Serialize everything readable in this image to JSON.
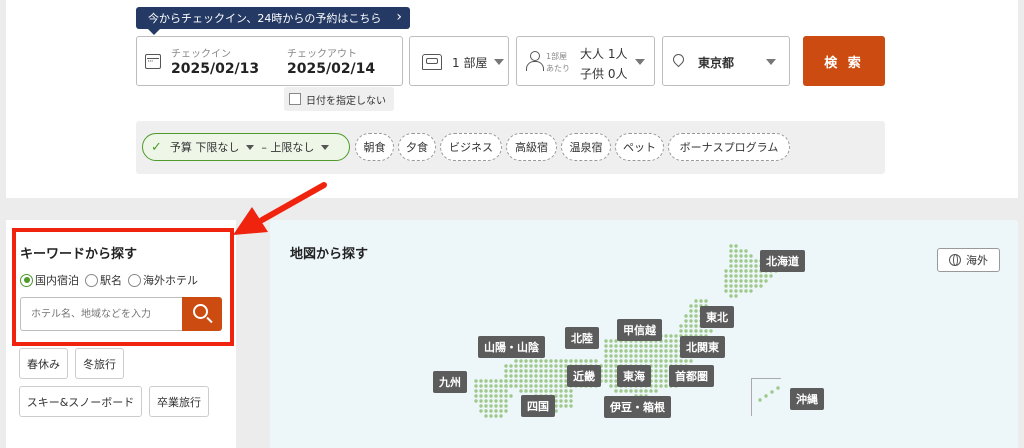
{
  "notice": {
    "text": "今からチェックイン、24時からの予約はこちら"
  },
  "dates": {
    "checkin_label": "チェックイン",
    "checkin_value": "2025/02/13",
    "checkout_label": "チェックアウト",
    "checkout_value": "2025/02/14",
    "no_date_label": "日付を指定しない"
  },
  "rooms": {
    "value": "1 部屋"
  },
  "guests": {
    "per_room_line1": "1部屋",
    "per_room_line2": "あたり",
    "adults": "大人 1人",
    "children": "子供 0人"
  },
  "location": {
    "value": "東京都"
  },
  "search_button": "検 索",
  "filters": {
    "budget_prefix": "予算",
    "budget_min": "下限なし",
    "budget_max": "– 上限なし",
    "chips": [
      "朝食",
      "夕食",
      "ビジネス",
      "高級宿",
      "温泉宿",
      "ペット",
      "ボーナスプログラム"
    ]
  },
  "keyword": {
    "title": "キーワードから探す",
    "radios": [
      "国内宿泊",
      "駅名",
      "海外ホテル"
    ],
    "selected_radio": "国内宿泊",
    "placeholder": "ホテル名、地域などを入力",
    "tags": [
      "春休み",
      "冬旅行",
      "スキー&スノーボード",
      "卒業旅行"
    ]
  },
  "map": {
    "title": "地図から探す",
    "overseas_button": "海外",
    "regions": [
      "北海道",
      "東北",
      "甲信越",
      "北陸",
      "北関東",
      "山陽・山陰",
      "近畿",
      "東海",
      "首都圏",
      "九州",
      "四国",
      "伊豆・箱根",
      "沖縄"
    ]
  },
  "colors": {
    "accent": "#cc4b10",
    "notice_bg": "#243a64",
    "highlight": "#f0230f",
    "selected_green": "#4e9a2b",
    "map_dot": "#9ec98a"
  }
}
